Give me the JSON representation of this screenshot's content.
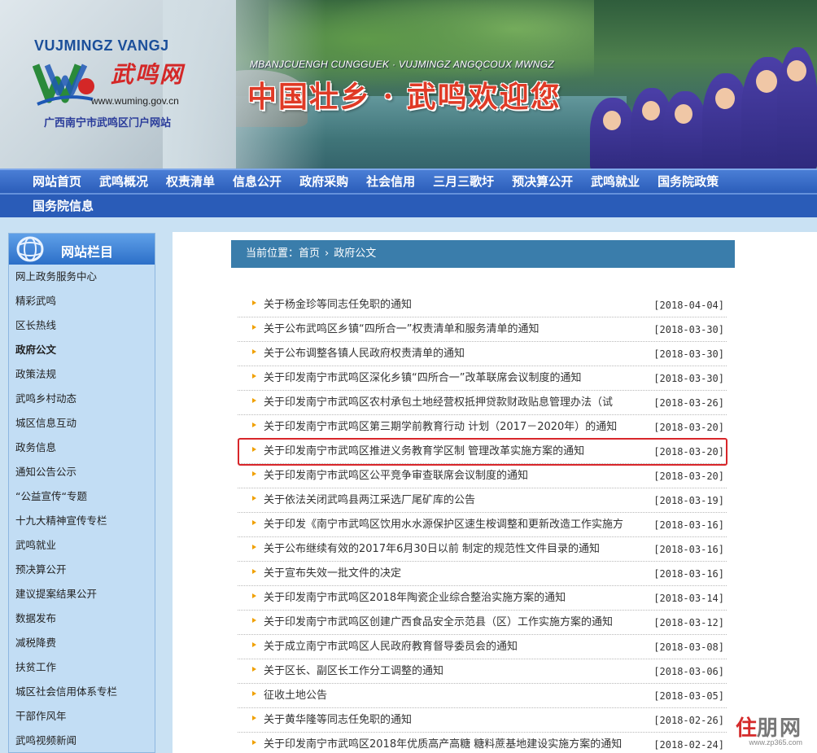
{
  "header": {
    "logo_en": "VUJMINGZ VANGJ",
    "logo_cn": "武鸣网",
    "logo_url": "www.wuming.gov.cn",
    "logo_sub": "广西南宁市武鸣区门户网站",
    "slogan_en": "MBANJCUENGH CUNGGUEK · VUJMINGZ ANGQCOUX MWNGZ",
    "slogan_cn": "中国壮乡 · 武鸣欢迎您"
  },
  "nav": {
    "row1": [
      "网站首页",
      "武鸣概况",
      "权责清单",
      "信息公开",
      "政府采购",
      "社会信用",
      "三月三歌圩",
      "预决算公开",
      "武鸣就业",
      "国务院政策"
    ],
    "row2": [
      "国务院信息"
    ]
  },
  "sidebar": {
    "title": "网站栏目",
    "items": [
      "网上政务服务中心",
      "精彩武鸣",
      "区长热线",
      "政府公文",
      "政策法规",
      "武鸣乡村动态",
      "城区信息互动",
      "政务信息",
      "通知公告公示",
      "“公益宣传“专题",
      "十九大精神宣传专栏",
      "武鸣就业",
      "预决算公开",
      "建议提案结果公开",
      "数据发布",
      "减税降费",
      "扶贫工作",
      "城区社会信用体系专栏",
      "干部作风年",
      "武鸣视频新闻"
    ],
    "active_index": 3
  },
  "breadcrumb": {
    "prefix": "当前位置：",
    "home": "首页",
    "current": "政府公文"
  },
  "news": [
    {
      "title": "关于杨金珍等同志任免职的通知",
      "date": "[2018-04-04]"
    },
    {
      "title": "关于公布武鸣区乡镇“四所合一”权责清单和服务清单的通知",
      "date": "[2018-03-30]"
    },
    {
      "title": "关于公布调整各镇人民政府权责清单的通知",
      "date": "[2018-03-30]"
    },
    {
      "title": "关于印发南宁市武鸣区深化乡镇“四所合一”改革联席会议制度的通知",
      "date": "[2018-03-30]"
    },
    {
      "title": "关于印发南宁市武鸣区农村承包土地经营权抵押贷款财政贴息管理办法（试",
      "date": "[2018-03-26]"
    },
    {
      "title": "关于印发南宁市武鸣区第三期学前教育行动 计划（2017－2020年）的通知",
      "date": "[2018-03-20]"
    },
    {
      "title": "关于印发南宁市武鸣区推进义务教育学区制 管理改革实施方案的通知",
      "date": "[2018-03-20]"
    },
    {
      "title": "关于印发南宁市武鸣区公平竞争审查联席会议制度的通知",
      "date": "[2018-03-20]"
    },
    {
      "title": "关于依法关闭武鸣县两江采选厂尾矿库的公告",
      "date": "[2018-03-19]"
    },
    {
      "title": "关于印发《南宁市武鸣区饮用水水源保护区速生桉调整和更新改造工作实施方",
      "date": "[2018-03-16]"
    },
    {
      "title": "关于公布继续有效的2017年6月30日以前 制定的规范性文件目录的通知",
      "date": "[2018-03-16]"
    },
    {
      "title": "关于宣布失效一批文件的决定",
      "date": "[2018-03-16]"
    },
    {
      "title": "关于印发南宁市武鸣区2018年陶瓷企业综合整治实施方案的通知",
      "date": "[2018-03-14]"
    },
    {
      "title": "关于印发南宁市武鸣区创建广西食品安全示范县（区）工作实施方案的通知",
      "date": "[2018-03-12]"
    },
    {
      "title": "关于成立南宁市武鸣区人民政府教育督导委员会的通知",
      "date": "[2018-03-08]"
    },
    {
      "title": "关于区长、副区长工作分工调整的通知",
      "date": "[2018-03-06]"
    },
    {
      "title": "征收土地公告",
      "date": "[2018-03-05]"
    },
    {
      "title": "关于黄华隆等同志任免职的通知",
      "date": "[2018-02-26]"
    },
    {
      "title": "关于印发南宁市武鸣区2018年优质高产高糖 糖料蔗基地建设实施方案的通知",
      "date": "[2018-02-24]"
    }
  ],
  "highlighted_index": 6,
  "watermark": {
    "mark": "住",
    "text": "朋网",
    "url": "www.zp365.com"
  },
  "colors": {
    "nav_bg": "#2a5cb8",
    "sidebar_bg": "#c2ddf4",
    "crumb_bg": "#3a7dab",
    "bullet": "#f0a000",
    "highlight": "#d8262a",
    "page_bg": "#c9e1f3"
  }
}
